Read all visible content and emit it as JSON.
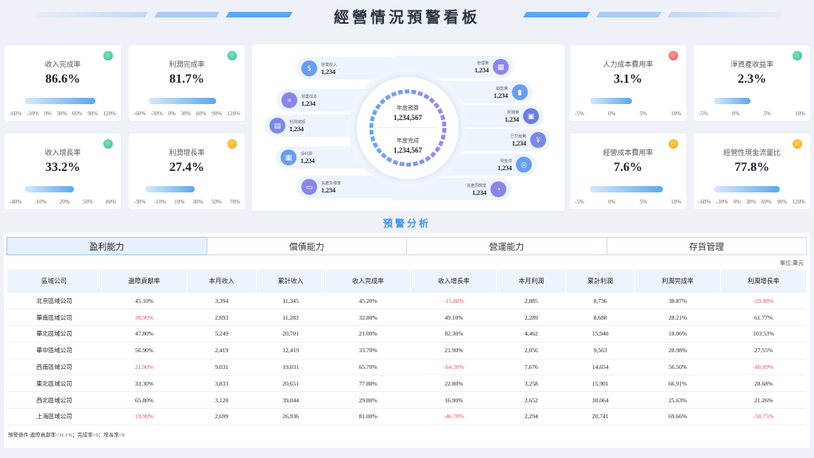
{
  "title": "經營情況預警看板",
  "kpi_cards": [
    {
      "label": "收入完成率",
      "value": "86.6%",
      "status": "green",
      "fill_from": -60,
      "fill_to": 86.6,
      "ticks": [
        "-60%",
        "-30%",
        "0%",
        "30%",
        "60%",
        "90%",
        "120%"
      ]
    },
    {
      "label": "利潤完成率",
      "value": "81.7%",
      "status": "green",
      "fill_from": -60,
      "fill_to": 81.7,
      "ticks": [
        "-60%",
        "-30%",
        "0%",
        "30%",
        "60%",
        "90%",
        "120%"
      ]
    },
    {
      "label": "收入增長率",
      "value": "33.2%",
      "status": "green",
      "fill_from": -40,
      "fill_to": 33.2,
      "ticks": [
        "-40%",
        "-10%",
        "20%",
        "50%",
        "80%"
      ]
    },
    {
      "label": "利潤增長率",
      "value": "27.4%",
      "status": "orange",
      "fill_from": -30,
      "fill_to": 27.4,
      "ticks": [
        "-30%",
        "-10%",
        "10%",
        "30%",
        "50%",
        "70%"
      ]
    },
    {
      "label": "人力成本費用率",
      "value": "3.1%",
      "status": "red",
      "fill_from": -5,
      "fill_to": 3.1,
      "ticks": [
        "-5%",
        "0%",
        "5%",
        "10%"
      ]
    },
    {
      "label": "淨資產收益率",
      "value": "2.3%",
      "status": "green",
      "fill_from": -5,
      "fill_to": 2.3,
      "ticks": [
        "-5%",
        "0%",
        "5%",
        "10%"
      ]
    },
    {
      "label": "經營成本費用率",
      "value": "7.6%",
      "status": "orange",
      "fill_from": -5,
      "fill_to": 7.6,
      "ticks": [
        "-5%",
        "0%",
        "5%",
        "10%"
      ]
    },
    {
      "label": "經營性現金流量比",
      "value": "77.8%",
      "status": "orange",
      "fill_from": -60,
      "fill_to": 77.8,
      "ticks": [
        "-60%",
        "-30%",
        "0%",
        "30%",
        "60%",
        "90%",
        "120%"
      ]
    }
  ],
  "center": {
    "budget_label": "年度預算",
    "budget_value": "1,234,567",
    "done_label": "年度完成",
    "done_value": "1,234,567",
    "left_items": [
      {
        "label": "營業收入",
        "value": "1,234",
        "icon": "money-bag-icon",
        "color": "#6a9df0"
      },
      {
        "label": "營業成本",
        "value": "1,234",
        "icon": "document-icon",
        "color": "#8a86e8"
      },
      {
        "label": "利潤總額",
        "value": "1,234",
        "icon": "ledger-icon",
        "color": "#7a88e6"
      },
      {
        "label": "淨利潤",
        "value": "1,234",
        "icon": "receipt-icon",
        "color": "#6a9df0"
      },
      {
        "label": "資產負債率",
        "value": "1,234",
        "icon": "card-icon",
        "color": "#8a86e8"
      }
    ],
    "right_items": [
      {
        "label": "管理費",
        "value": "1,234",
        "icon": "calendar-icon",
        "color": "#8a86e8"
      },
      {
        "label": "銷售費",
        "value": "1,234",
        "icon": "bar-chart-icon",
        "color": "#6a9df0"
      },
      {
        "label": "財務費",
        "value": "1,234",
        "icon": "clipboard-icon",
        "color": "#6a7fe0"
      },
      {
        "label": "巳交稅費",
        "value": "1,234",
        "icon": "tax-icon",
        "color": "#7a88e6"
      },
      {
        "label": "現金流",
        "value": "1,234",
        "icon": "coins-icon",
        "color": "#6a9df0"
      },
      {
        "label": "資產周轉率",
        "value": "1,234",
        "icon": "pie-icon",
        "color": "#8a86e8"
      }
    ]
  },
  "section_title": "預警分析",
  "tabs": [
    "盈利能力",
    "償債能力",
    "營運能力",
    "存貨管理"
  ],
  "active_tab": 0,
  "unit": "單位:萬元",
  "table": {
    "headers": [
      "區域公司",
      "邊際貢獻率",
      "本月收入",
      "累計收入",
      "收入完成率",
      "收入增長率",
      "本月利潤",
      "累計利潤",
      "利潤完成率",
      "利潤增長率"
    ],
    "rows": [
      [
        "北京區域公司",
        "45.10%",
        "3,394",
        "11,345",
        "45.20%",
        "-15.80%",
        "2,885",
        "8,736",
        "38.87%",
        "-19.88%"
      ],
      [
        "華南區域公司",
        "30.90%",
        "2,693",
        "11,283",
        "32.80%",
        "49.10%",
        "2,289",
        "8,688",
        "28.21%",
        "61.77%"
      ],
      [
        "華北區域公司",
        "47.80%",
        "5,249",
        "20,701",
        "21.00%",
        "82.30%",
        "4,462",
        "15,940",
        "18.06%",
        "103.53%"
      ],
      [
        "華中區域公司",
        "56.90%",
        "2,419",
        "12,419",
        "33.70%",
        "21.90%",
        "2,056",
        "9,563",
        "28.98%",
        "27.55%"
      ],
      [
        "西南區域公司",
        "21.90%",
        "9,031",
        "19,031",
        "65.70%",
        "-64.30%",
        "7,676",
        "14,654",
        "56.50%",
        "-80.89%"
      ],
      [
        "東北區域公司",
        "33.30%",
        "3,833",
        "20,651",
        "77.80%",
        "22.80%",
        "3,258",
        "15,901",
        "66.91%",
        "28.68%"
      ],
      [
        "西北區域公司",
        "65.80%",
        "3,120",
        "39,044",
        "29.80%",
        "16.90%",
        "2,652",
        "30,064",
        "25.63%",
        "21.26%"
      ],
      [
        "上海區域公司",
        "19.90%",
        "2,699",
        "26,936",
        "81.00%",
        "-46.70%",
        "2,294",
        "20,741",
        "69.66%",
        "-58.75%"
      ]
    ],
    "red_cells": [
      [
        0,
        5
      ],
      [
        0,
        9
      ],
      [
        1,
        1
      ],
      [
        4,
        1
      ],
      [
        4,
        5
      ],
      [
        4,
        9
      ],
      [
        7,
        1
      ],
      [
        7,
        5
      ],
      [
        7,
        9
      ]
    ]
  },
  "footnote": "預警條件:邊際貢獻率<31.1%；完成率<0；增長率<0",
  "colors": {
    "accent": "#3d96e8",
    "warning_red": "#e8505b",
    "green": "#37b990",
    "orange": "#f2a20a"
  }
}
